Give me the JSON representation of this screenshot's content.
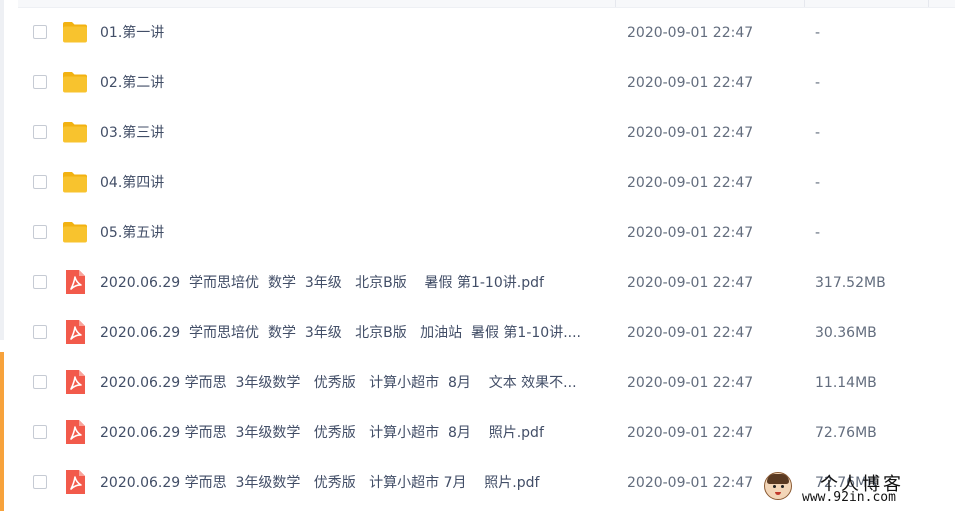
{
  "files": [
    {
      "type": "folder",
      "icon": "folder-icon",
      "name": "01.第一讲",
      "date": "2020-09-01 22:47",
      "size": "-"
    },
    {
      "type": "folder",
      "icon": "folder-icon",
      "name": "02.第二讲",
      "date": "2020-09-01 22:47",
      "size": "-"
    },
    {
      "type": "folder",
      "icon": "folder-icon",
      "name": "03.第三讲",
      "date": "2020-09-01 22:47",
      "size": "-"
    },
    {
      "type": "folder",
      "icon": "folder-icon",
      "name": "04.第四讲",
      "date": "2020-09-01 22:47",
      "size": "-"
    },
    {
      "type": "folder",
      "icon": "folder-icon",
      "name": "05.第五讲",
      "date": "2020-09-01 22:47",
      "size": "-"
    },
    {
      "type": "pdf",
      "icon": "pdf-icon",
      "name": "2020.06.29  学而思培优  数学  3年级   北京B版    暑假 第1-10讲.pdf",
      "date": "2020-09-01 22:47",
      "size": "317.52MB"
    },
    {
      "type": "pdf",
      "icon": "pdf-icon",
      "name": "2020.06.29  学而思培优  数学  3年级   北京B版   加油站  暑假 第1-10讲....",
      "date": "2020-09-01 22:47",
      "size": "30.36MB"
    },
    {
      "type": "pdf",
      "icon": "pdf-icon",
      "name": "2020.06.29 学而思  3年级数学   优秀版   计算小超市  8月    文本 效果不...",
      "date": "2020-09-01 22:47",
      "size": "11.14MB"
    },
    {
      "type": "pdf",
      "icon": "pdf-icon",
      "name": "2020.06.29 学而思  3年级数学   优秀版   计算小超市  8月    照片.pdf",
      "date": "2020-09-01 22:47",
      "size": "72.76MB"
    },
    {
      "type": "pdf",
      "icon": "pdf-icon",
      "name": "2020.06.29 学而思  3年级数学   优秀版   计算小超市 7月    照片.pdf",
      "date": "2020-09-01 22:47",
      "size": "72.76MB"
    }
  ],
  "watermark": {
    "title": "个人博客",
    "url": "www.92in.com"
  },
  "colors": {
    "folder": "#f8c32e",
    "folder_tab": "#f2b211",
    "pdf": "#f25a4b",
    "accent_edge": "#f7a23b"
  }
}
